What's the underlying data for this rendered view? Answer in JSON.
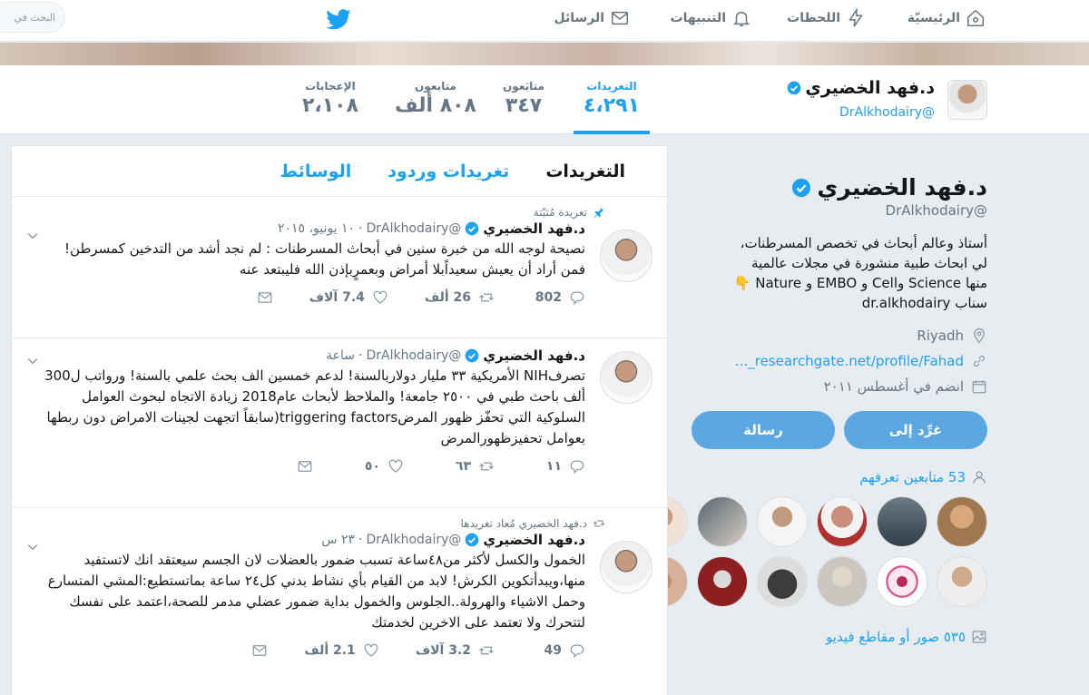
{
  "nav": {
    "home": "الرئيسيّة",
    "moments": "اللحظات",
    "notifications": "التنبيهات",
    "messages": "الرسائل",
    "search_placeholder": "البحث في"
  },
  "profile": {
    "name": "د.فهد الخضيري",
    "handle": "@DrAlkhodairy",
    "bio_lines": [
      "أستاذ وعالم أبحاث في تخصص المسرطنات،",
      "لي ابحاث طبية منشورة في مجلات عالمية",
      "منها Science وCell و EMBO و Nature 👇",
      "سناب dr.alkhodairy"
    ],
    "location": "Riyadh",
    "url": "researchgate.net/profile/Fahad_...",
    "joined": "انضم في أغسطس ٢٠١١",
    "follow_btn": "غرِّد إلى",
    "message_btn": "رسالة",
    "followers_you_know": "53 متابعين تعرفهم",
    "media_link": "٥٣٥ صور أو مقاطع فيديو",
    "accent": "#1da1f2"
  },
  "stats": [
    {
      "label": "التغريدات",
      "value": "٤،٢٩١"
    },
    {
      "label": "متابَعون",
      "value": "٣٤٧"
    },
    {
      "label": "متابعون",
      "value": "٨٠٨ ألف"
    },
    {
      "label": "الإعجابات",
      "value": "٢،١٠٨"
    }
  ],
  "tabs": [
    "التغريدات",
    "تغريدات وردود",
    "الوسائط"
  ],
  "tweets": [
    {
      "context": "تغريدة مُثبّتة",
      "name": "د.فهد الخضيري",
      "handle": "@DrAlkhodairy",
      "time": "١٠ يونيو، ٢٠١٥",
      "text": "نصيحة لوجه الله من خبرة سنين في أبحاث المسرطنات : لم نجد أشد من التدخين كمسرطن! فمن أراد أن يعيش سعيداًبلا أمراض وبعمرٍبإذن الله فليبتعد عنه",
      "replies": "802",
      "retweets": "26 ألف",
      "likes": "7.4 آلاف"
    },
    {
      "context": "",
      "name": "د.فهد الخضيري",
      "handle": "@DrAlkhodairy",
      "time": "ساعة",
      "text": "تصرفNIH الأمريكية ٣٣ مليار دولاربالسنة! لدعم خمسين الف بحث علمي بالسنة! ورواتب ل300 ألف باحث طبي في ٢٥٠٠ جامعة! والملاحظ لأبحاث عام2018 زيادة الاتجاه لبحوث العوامل السلوكية التي تحفّز ظهور المرضtriggering factors(سابقاً اتجهت لجينات الامراض دون ربطها بعوامل تحفيزظهورالمرض",
      "replies": "١١",
      "retweets": "٦٣",
      "likes": "٥٠"
    },
    {
      "context": "د.فهد الخضيري مُعاد تغريدها",
      "name": "د.فهد الخضيري",
      "handle": "@DrAlkhodairy",
      "time": "٢٣ س",
      "text": "الخمول والكسل لأكثر من٤٨ساعة تسبب ضمور بالعضلات لان الجسم سيعتقد انك لاتستفيد منها،ويبدأتكوين الكرش! لابد من القيام بأي نشاط بدني كل٢٤ ساعة بماتستطيع:المشي المتسارع وحمل الاشياء والهرولة..الجلوس والخمول بداية ضمور عضلي مدمر للصحة،اعتمد على نفسك لتتحرك ولا تعتمد على الاخرين لخدمتك",
      "replies": "49",
      "retweets": "3.2 آلاف",
      "likes": "2.1 ألف"
    }
  ]
}
